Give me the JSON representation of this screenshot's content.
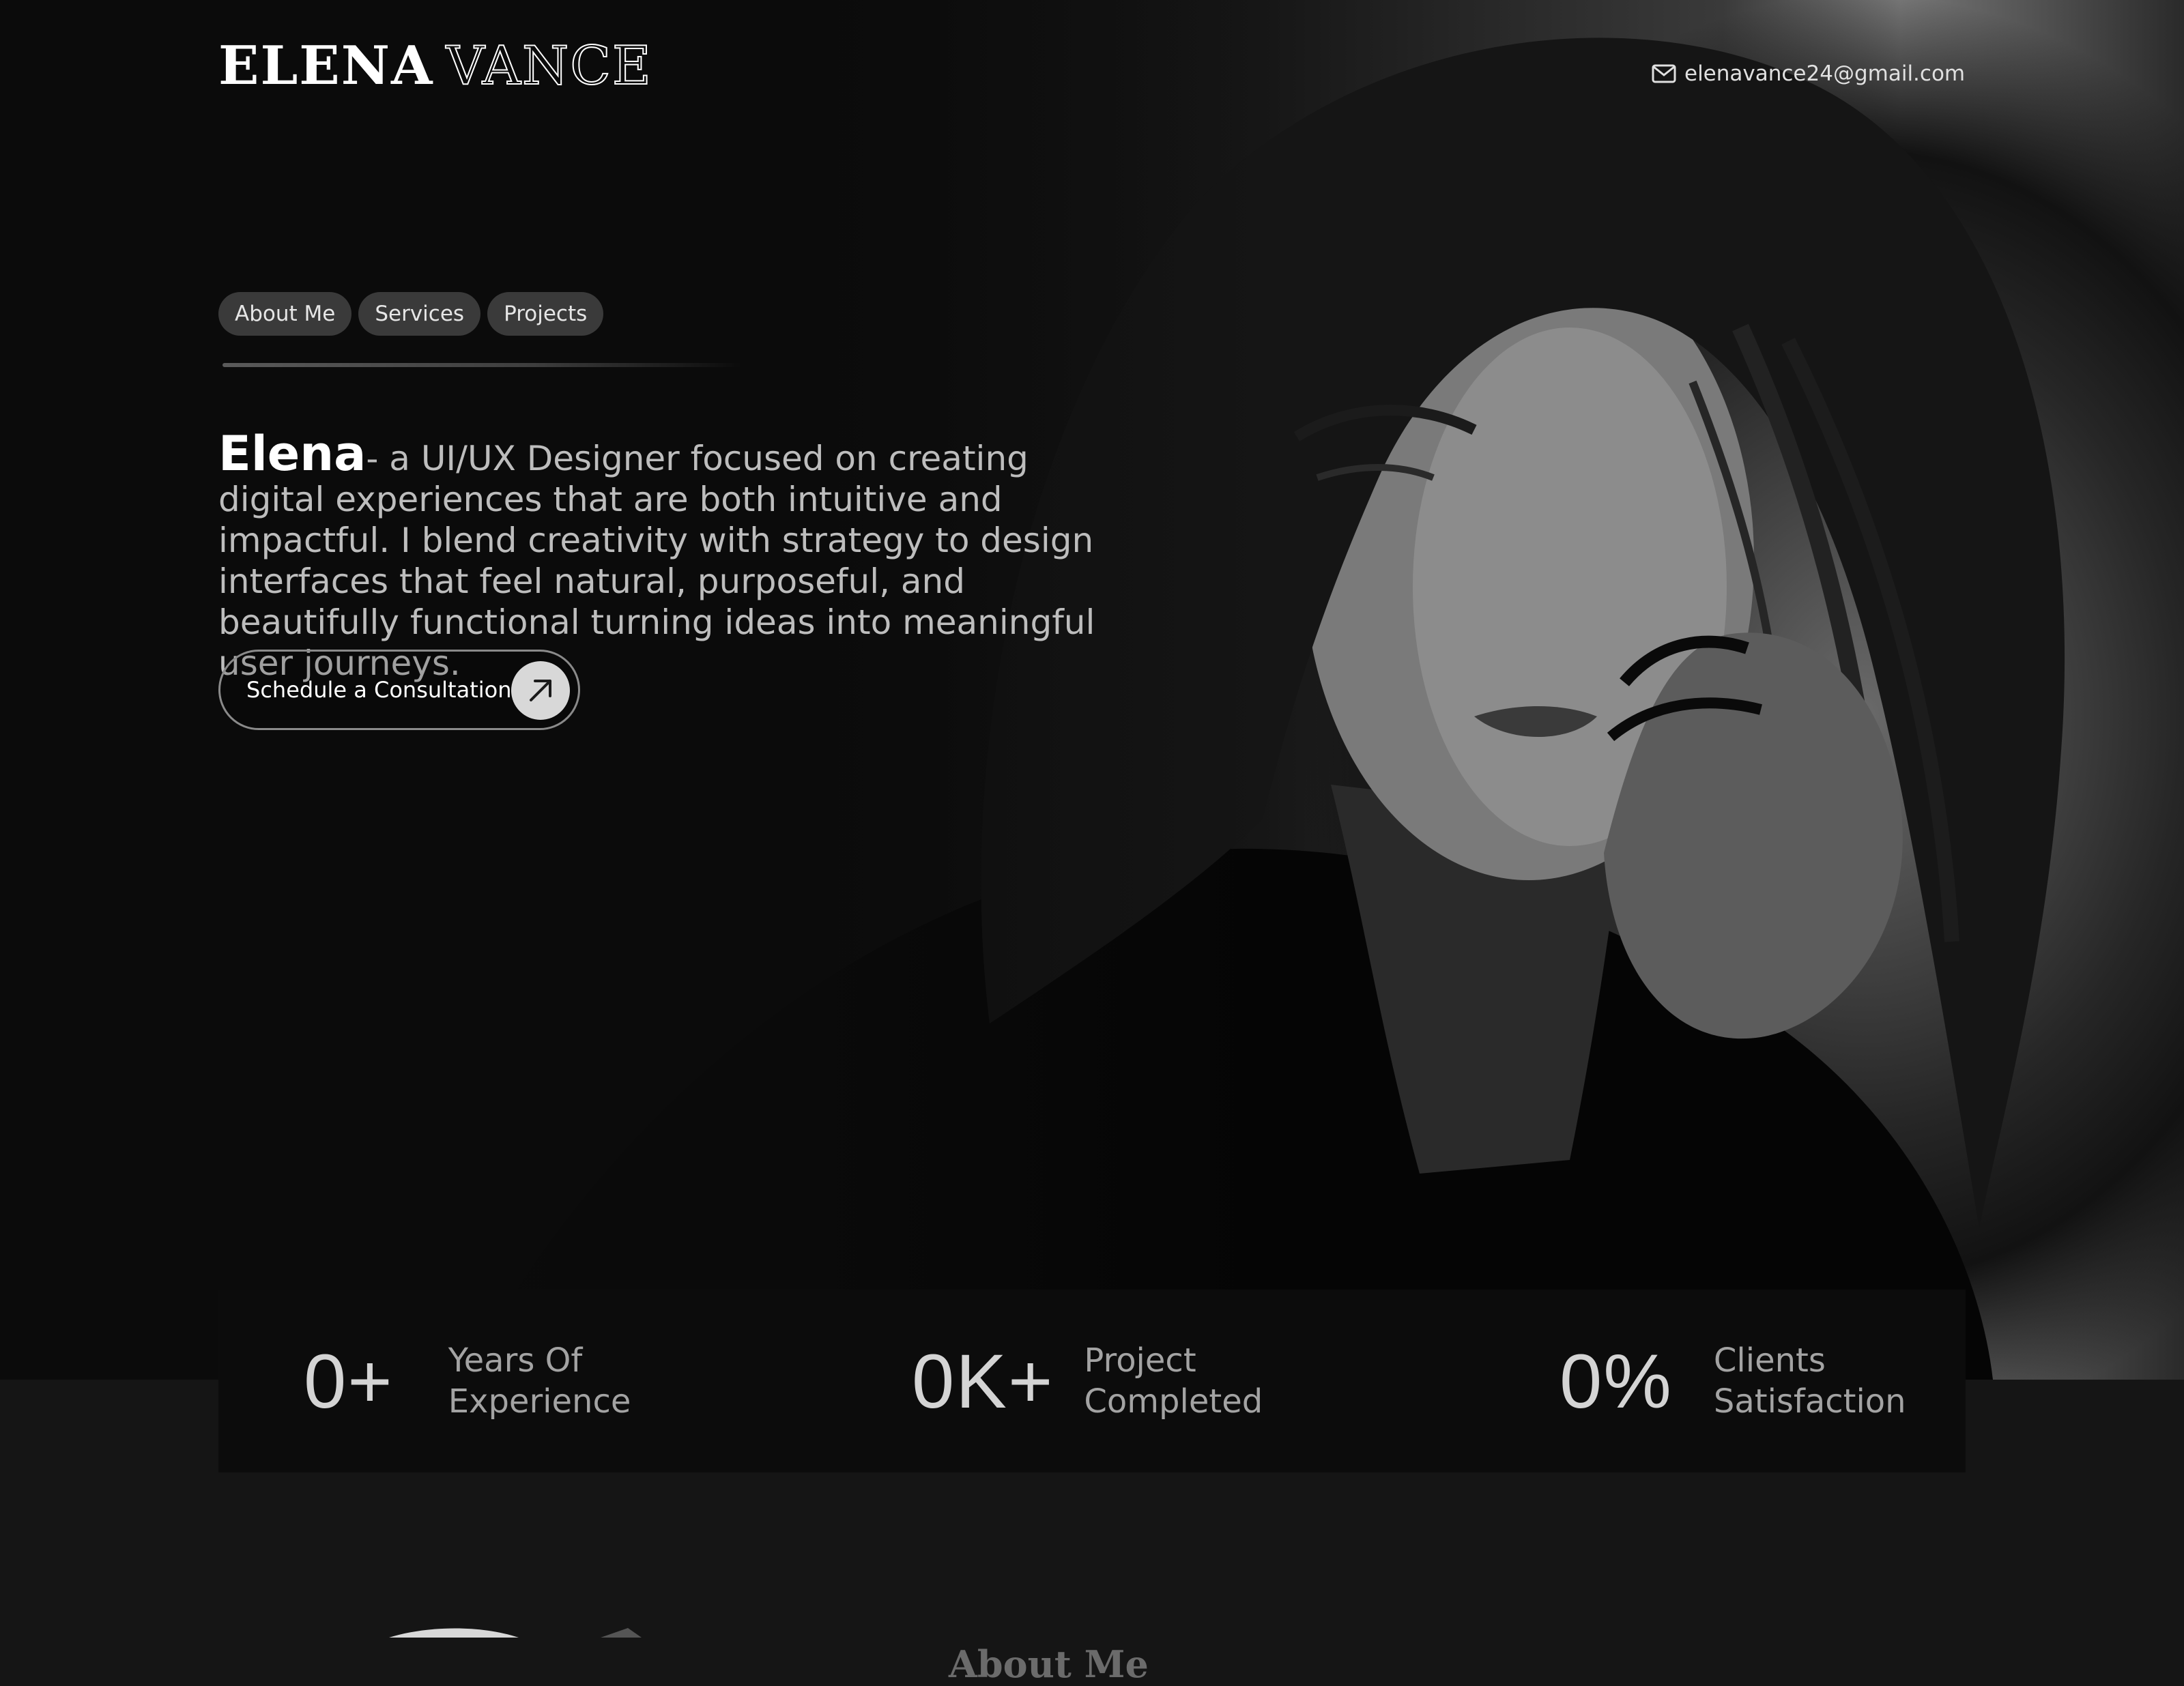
{
  "brand": {
    "first_name": "ELENA",
    "last_name": "VANCE"
  },
  "contact": {
    "icon": "mail-icon",
    "email": "elenavance24@gmail.com"
  },
  "nav": {
    "items": [
      {
        "label": "About Me"
      },
      {
        "label": "Services"
      },
      {
        "label": "Projects"
      }
    ]
  },
  "hero": {
    "name": "Elena",
    "intro": "- a UI/UX Designer focused on creating digital experiences that are both intuitive and impactful. I blend creativity with strategy to design interfaces that feel natural, purposeful, and beautifully functional turning ideas into meaningful user journeys.",
    "cta_label": "Schedule a Consultation",
    "cta_icon": "arrow-up-right-icon"
  },
  "stats": [
    {
      "value": "0+",
      "label_line1": "Years Of",
      "label_line2": "Experience"
    },
    {
      "value": "0K+",
      "label_line1": "Project",
      "label_line2": "Completed"
    },
    {
      "value": "0%",
      "label_line1": "Clients",
      "label_line2": "Satisfaction"
    }
  ],
  "about": {
    "heading": "About Me"
  },
  "colors": {
    "page_bg": "#151515",
    "hero_bg": "#0b0b0b",
    "pill_bg": "#3a3a3a",
    "text_primary": "#ffffff",
    "text_muted": "#bdbdbd"
  }
}
